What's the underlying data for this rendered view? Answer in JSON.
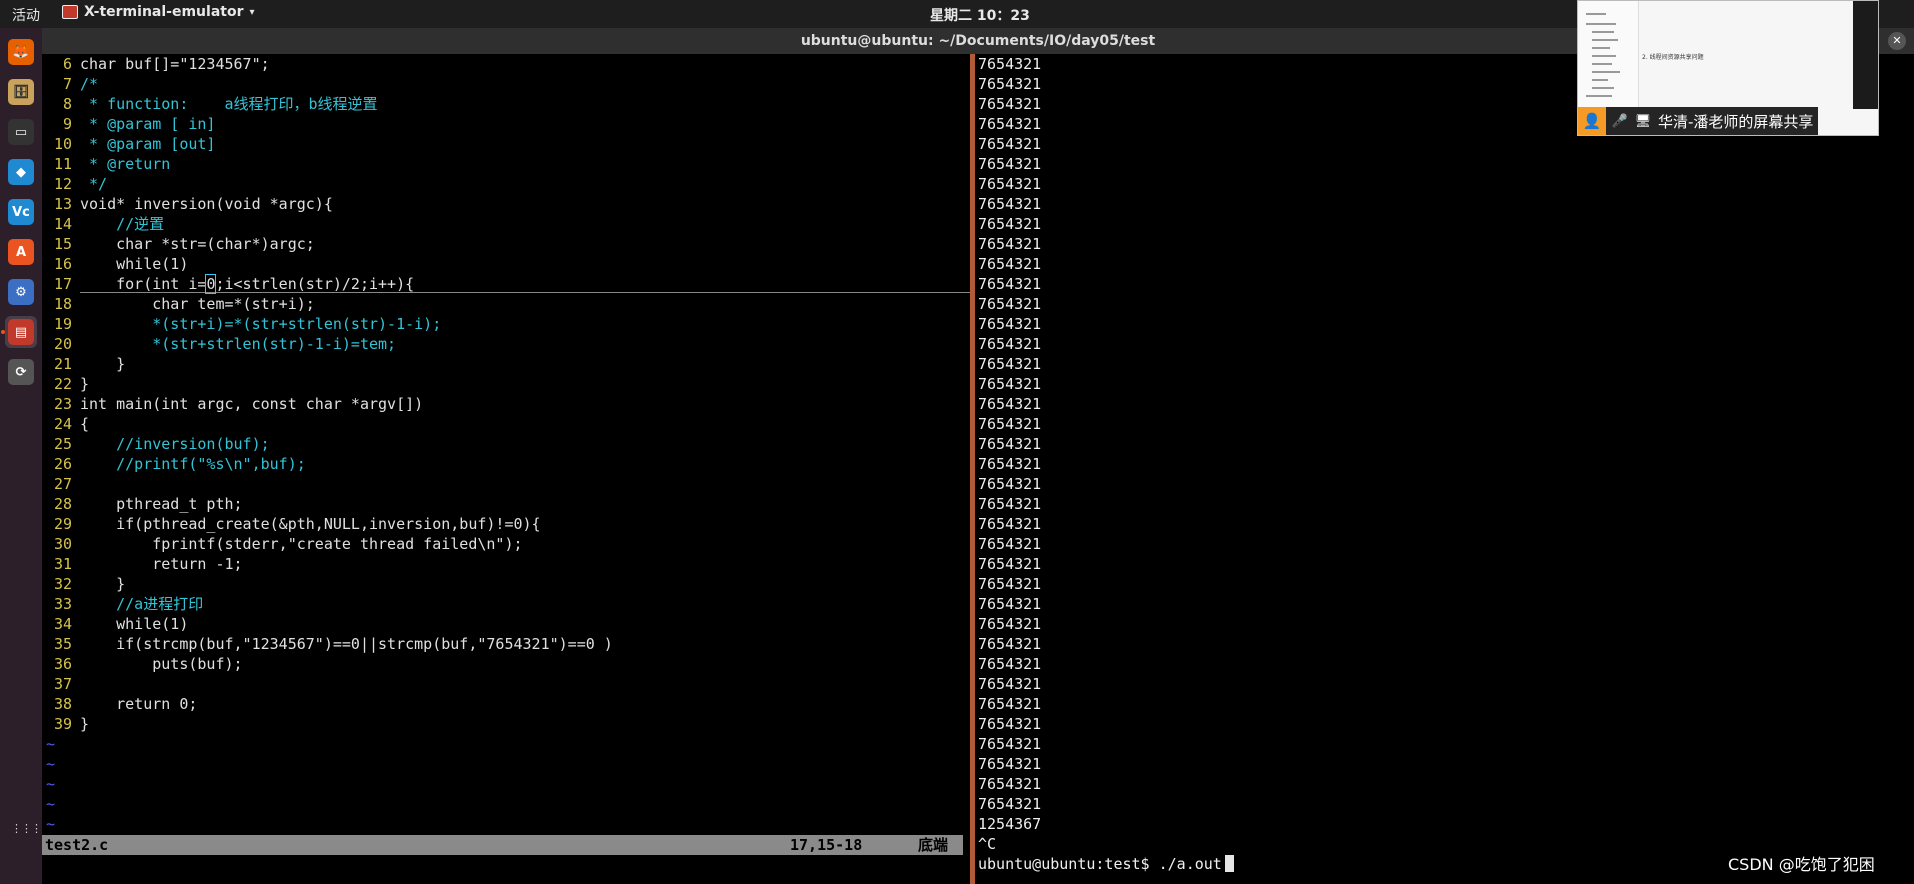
{
  "topbar": {
    "activities": "活动",
    "app_name": "X-terminal-emulator",
    "app_caret": "▾",
    "clock": "星期二 10：23"
  },
  "window": {
    "title": "ubuntu@ubuntu: ~/Documents/IO/day05/test",
    "close_glyph": "✕"
  },
  "dock": {
    "icons": [
      "firefox-icon",
      "file-manager-icon",
      "terminal-icon",
      "vscode-icon",
      "vc-icon",
      "software-center-icon",
      "network-tool-icon",
      "x-terminal-icon",
      "update-icon",
      "show-apps-icon"
    ],
    "glyphs": [
      "🦊",
      "🗄",
      "▭",
      "◆",
      "Vc",
      "A",
      "⚙",
      "▤",
      "⟳",
      "⋮⋮⋮"
    ]
  },
  "vim": {
    "lines": [
      {
        "n": "6",
        "t": "char buf[]=\"1234567\";"
      },
      {
        "n": "7",
        "t": "/*"
      },
      {
        "n": "8",
        "t": " * function:    a线程打印，b线程逆置"
      },
      {
        "n": "9",
        "t": " * @param [ in]"
      },
      {
        "n": "10",
        "t": " * @param [out]"
      },
      {
        "n": "11",
        "t": " * @return"
      },
      {
        "n": "12",
        "t": " */"
      },
      {
        "n": "13",
        "t": "void* inversion(void *argc){"
      },
      {
        "n": "14",
        "t": "    //逆置"
      },
      {
        "n": "15",
        "t": "    char *str=(char*)argc;"
      },
      {
        "n": "16",
        "t": "    while(1)"
      },
      {
        "n": "17",
        "t": "    for(int i=0;i<strlen(str)/2;i++){"
      },
      {
        "n": "18",
        "t": "        char tem=*(str+i);"
      },
      {
        "n": "19",
        "t": "        *(str+i)=*(str+strlen(str)-1-i);"
      },
      {
        "n": "20",
        "t": "        *(str+strlen(str)-1-i)=tem;"
      },
      {
        "n": "21",
        "t": "    }"
      },
      {
        "n": "22",
        "t": "}"
      },
      {
        "n": "23",
        "t": "int main(int argc, const char *argv[])"
      },
      {
        "n": "24",
        "t": "{"
      },
      {
        "n": "25",
        "t": "    //inversion(buf);"
      },
      {
        "n": "26",
        "t": "    //printf(\"%s\\n\",buf);"
      },
      {
        "n": "27",
        "t": ""
      },
      {
        "n": "28",
        "t": "    pthread_t pth;"
      },
      {
        "n": "29",
        "t": "    if(pthread_create(&pth,NULL,inversion,buf)!=0){"
      },
      {
        "n": "30",
        "t": "        fprintf(stderr,\"create thread failed\\n\");"
      },
      {
        "n": "31",
        "t": "        return -1;"
      },
      {
        "n": "32",
        "t": "    }"
      },
      {
        "n": "33",
        "t": "    //a进程打印"
      },
      {
        "n": "34",
        "t": "    while(1)"
      },
      {
        "n": "35",
        "t": "    if(strcmp(buf,\"1234567\")==0||strcmp(buf,\"7654321\")==0 )"
      },
      {
        "n": "36",
        "t": "        puts(buf);"
      },
      {
        "n": "37",
        "t": ""
      },
      {
        "n": "38",
        "t": "    return 0;"
      },
      {
        "n": "39",
        "t": "}"
      }
    ],
    "tilde": "~",
    "tilde_count": 5,
    "status": {
      "filename": "test2.c",
      "position": "17,15-18",
      "scroll": "底端"
    }
  },
  "terminal": {
    "output_lines": [
      "7654321",
      "7654321",
      "7654321",
      "7654321",
      "7654321",
      "7654321",
      "7654321",
      "7654321",
      "7654321",
      "7654321",
      "7654321",
      "7654321",
      "7654321",
      "7654321",
      "7654321",
      "7654321",
      "7654321",
      "7654321",
      "7654321",
      "7654321",
      "7654321",
      "7654321",
      "7654321",
      "7654321",
      "7654321",
      "7654321",
      "7654321",
      "7654321",
      "7654321",
      "7654321",
      "7654321",
      "7654321",
      "7654321",
      "7654321",
      "7654321",
      "7654321",
      "7654321",
      "7654321",
      "1254367",
      "^C"
    ],
    "prompt": "ubuntu@ubuntu:test$ ./a.out"
  },
  "screen_share": {
    "label": "华清-潘老师的屏幕共享",
    "mini_title": "2. 线程间资源共享问题",
    "avatar_glyph": "👤",
    "mic_glyph": "🎤",
    "screen_glyph": "🖥"
  },
  "watermark": "CSDN @吃饱了犯困"
}
